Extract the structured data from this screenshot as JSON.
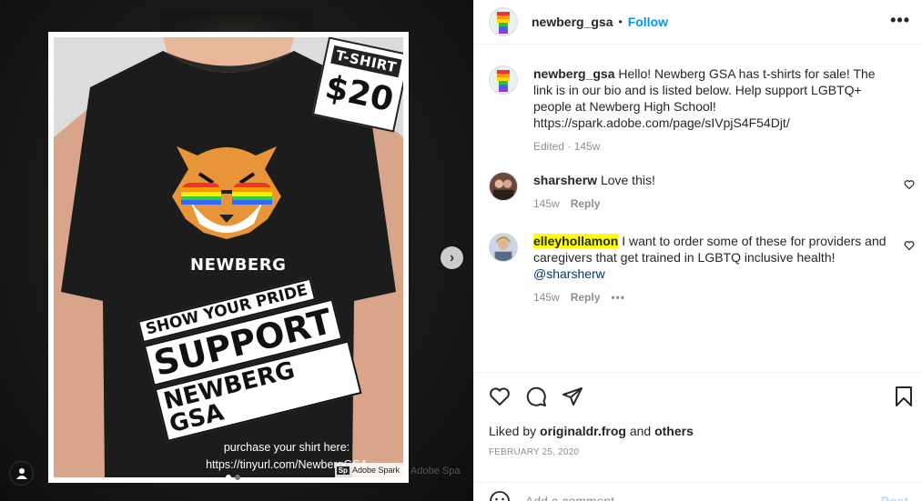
{
  "media": {
    "price_label": "T-SHIRT",
    "price_value": "$20",
    "brand": "NEWBERG",
    "slogan": [
      "SHOW YOUR PRIDE",
      "SUPPORT",
      "NEWBERG GSA"
    ],
    "purchase_line1": "purchase your shirt here:",
    "purchase_line2": "https://tinyurl.com/NewbergGSA",
    "badge_logo": "Sp",
    "badge_text": "Adobe Spark",
    "ghost_text": "Adobe Spa",
    "next_icon": "chevron-right-icon",
    "user_tag_icon": "user-icon"
  },
  "header": {
    "username": "newberg_gsa",
    "separator": "•",
    "follow_label": "Follow",
    "more_icon": "more-horizontal-icon"
  },
  "caption": {
    "username": "newberg_gsa",
    "text": "Hello! Newberg GSA has t-shirts for sale! The link is in our bio and is listed below. Help support LGBTQ+ people at Newberg High School! https://spark.adobe.com/page/sIVpjS4F54Djt/",
    "edited": "Edited",
    "time": "145w"
  },
  "comments": [
    {
      "username": "sharsherw",
      "text": "Love this!",
      "time": "145w",
      "reply_label": "Reply"
    },
    {
      "username": "elleyhollamon",
      "text": "I want to order some of these for providers and caregivers that get trained in LGBTQ inclusive health!",
      "mention": "@sharsherw",
      "time": "145w",
      "reply_label": "Reply",
      "more_label": "•••"
    }
  ],
  "actions": {
    "liked_prefix": "Liked by",
    "liked_user": "originaldr.frog",
    "liked_and": "and",
    "liked_others": "others",
    "date": "FEBRUARY 25, 2020",
    "comment_placeholder": "Add a comment...",
    "post_label": "Post"
  },
  "colors": {
    "accent": "#0095f6",
    "highlight": "#ffff00",
    "post_disabled": "#b2dffc",
    "muted": "#8e8e8e"
  }
}
